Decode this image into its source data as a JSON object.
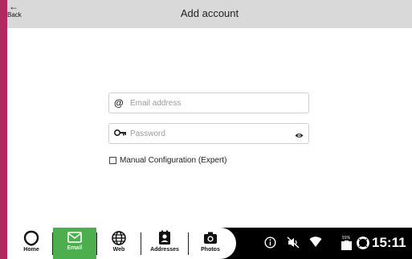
{
  "header": {
    "back_arrow": "←",
    "back_label": "Back",
    "title": "Add account"
  },
  "form": {
    "email": {
      "placeholder": "Email address",
      "value": "",
      "icon": "at-icon"
    },
    "password": {
      "placeholder": "Password",
      "value": "",
      "icon": "key-icon",
      "toggle_icon": "eye-icon"
    },
    "manual_config": {
      "label": "Manual Configuration (Expert)",
      "checked": false
    }
  },
  "nav": {
    "active": "Email",
    "tabs": [
      {
        "label": "Home",
        "icon": "home-icon"
      },
      {
        "label": "Email",
        "icon": "mail-icon"
      },
      {
        "label": "Web",
        "icon": "globe-icon"
      },
      {
        "label": "Addresses",
        "icon": "contacts-icon"
      },
      {
        "label": "Photos",
        "icon": "camera-icon"
      }
    ]
  },
  "status_bar": {
    "icons": [
      "info-icon",
      "mute-icon",
      "wifi-icon",
      "battery-icon",
      "lifebuoy-icon"
    ],
    "battery_percent": "91%",
    "time": "15:11"
  },
  "colors": {
    "accent_stripe": "#b3285f",
    "active_tab": "#4cae4c",
    "topbar": "#d9d9d9",
    "navbar": "#000000"
  }
}
